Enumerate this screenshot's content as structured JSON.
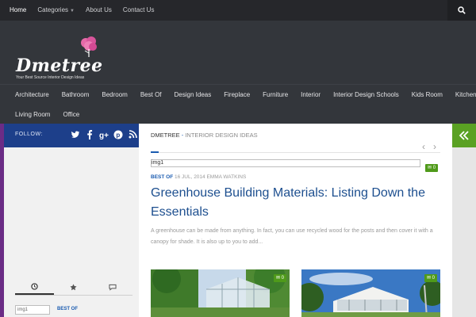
{
  "topnav": {
    "items": [
      "Home",
      "Categories",
      "About Us",
      "Contact Us"
    ]
  },
  "logo": {
    "text": "Dmetree",
    "tagline": "Your Best Source Interior Design Ideas"
  },
  "categories": {
    "row1": [
      "Architecture",
      "Bathroom",
      "Bedroom",
      "Best Of",
      "Design Ideas",
      "Fireplace",
      "Furniture",
      "Interior",
      "Interior Design Schools",
      "Kids Room",
      "Kitchen"
    ],
    "row2": [
      "Living Room",
      "Office"
    ]
  },
  "sidebar": {
    "follow_label": "FOLLOW:",
    "social_icons": [
      "twitter-icon",
      "facebook-icon",
      "google-plus-icon",
      "pinterest-icon",
      "rss-icon"
    ],
    "tab_icons": [
      "clock-icon",
      "star-icon",
      "comments-icon"
    ],
    "post_thumb_alt": "img1",
    "post_category": "BEST OF"
  },
  "breadcrumb": {
    "site": "DMETREE",
    "separator": " - ",
    "subtitle": "INTERIOR DESIGN IDEAS"
  },
  "featured": {
    "image_alt": "img1",
    "comments": "0",
    "category": "BEST OF",
    "date_author": "16 JUL, 2014 EMMA WATKINS",
    "title": "Greenhouse Building Materials: Listing Down the Essentials",
    "excerpt": "A greenhouse can be made from anything. In fact, you can use recycled wood for the posts and then cover it with a canopy for shade. It is also up to you to add..."
  },
  "thumbs": [
    {
      "comments": "0"
    },
    {
      "comments": "0"
    }
  ],
  "colors": {
    "accent_blue": "#1a5bb0",
    "accent_green": "#5aa123",
    "sidebar_border": "#6b2c86"
  }
}
